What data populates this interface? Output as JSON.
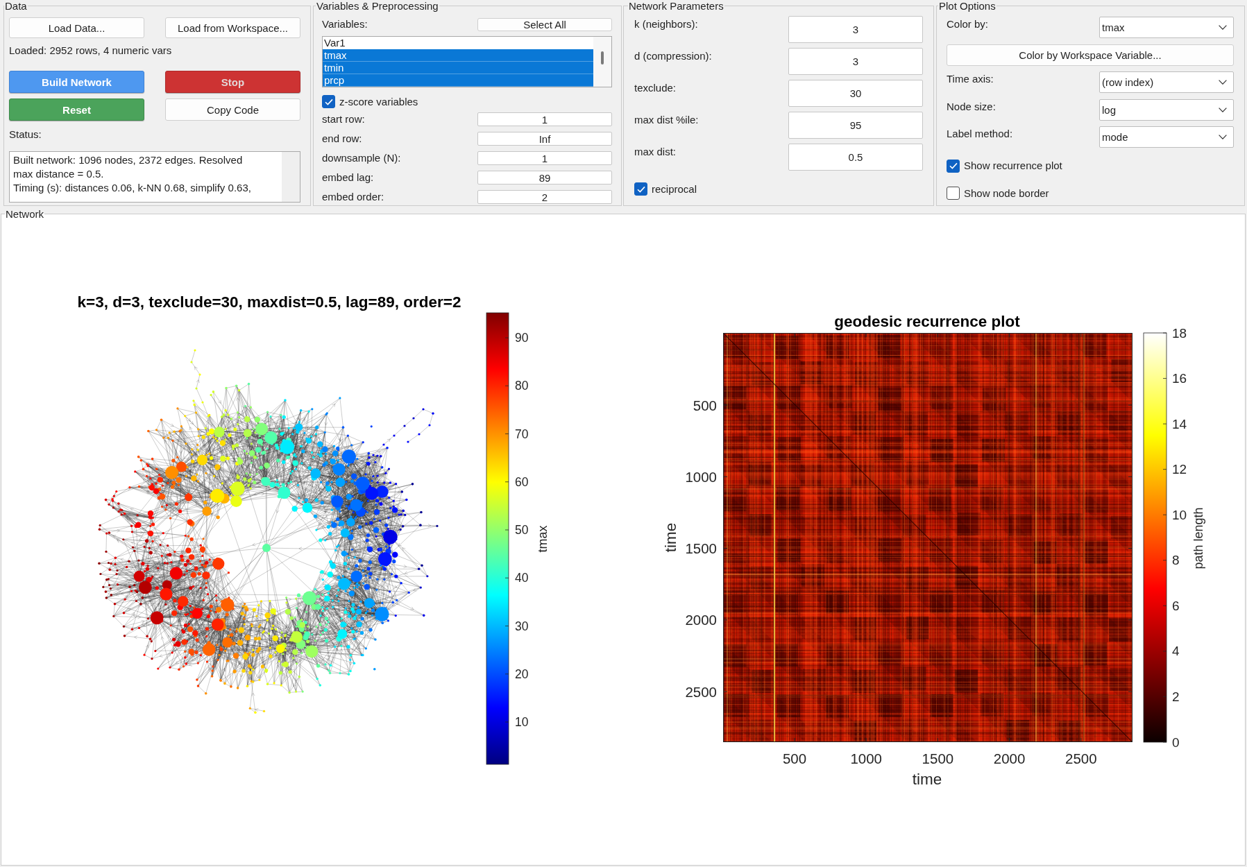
{
  "data_panel": {
    "title": "Data",
    "load_buttons": [
      "Load Data...",
      "Load from Workspace..."
    ],
    "loaded_info": "Loaded: 2952 rows, 4 numeric vars",
    "action_buttons": [
      {
        "label": "Build Network",
        "kind": "primary",
        "disabled": false
      },
      {
        "label": "Stop",
        "kind": "danger",
        "disabled": true
      },
      {
        "label": "Reset",
        "kind": "success",
        "disabled": false
      },
      {
        "label": "Copy Code",
        "kind": "plain",
        "disabled": false
      }
    ],
    "status_label": "Status:",
    "status_lines": [
      "Built network: 1096 nodes, 2372 edges. Resolved max distance = 0.5.",
      "Timing (s): distances 0.06, k-NN 0.68, simplify 0.63,"
    ]
  },
  "variables_panel": {
    "title": "Variables & Preprocessing",
    "variables_label": "Variables:",
    "select_all_button": "Select All",
    "variables": [
      {
        "name": "Var1",
        "selected": false
      },
      {
        "name": "tmax",
        "selected": true
      },
      {
        "name": "tmin",
        "selected": true
      },
      {
        "name": "prcp",
        "selected": true
      }
    ],
    "zscore": {
      "label": "z-score variables",
      "checked": true
    },
    "fields": [
      {
        "label": "start row:",
        "value": "1"
      },
      {
        "label": "end row:",
        "value": "Inf"
      },
      {
        "label": "downsample (N):",
        "value": "1"
      },
      {
        "label": "embed lag:",
        "value": "89"
      },
      {
        "label": "embed order:",
        "value": "2"
      }
    ]
  },
  "network_parameters": {
    "title": "Network Parameters",
    "fields": [
      {
        "label": "k (neighbors):",
        "value": "3"
      },
      {
        "label": "d (compression):",
        "value": "3"
      },
      {
        "label": "texclude:",
        "value": "30"
      },
      {
        "label": "max dist %ile:",
        "value": "95"
      },
      {
        "label": "max dist:",
        "value": "0.5"
      }
    ],
    "reciprocal": {
      "label": "reciprocal",
      "checked": true
    }
  },
  "plot_options": {
    "title": "Plot Options",
    "rows": [
      {
        "kind": "dropdown",
        "label": "Color by:",
        "value": "tmax"
      },
      {
        "kind": "button",
        "label": "Color by Workspace Variable..."
      },
      {
        "kind": "dropdown",
        "label": "Time axis:",
        "value": "(row index)"
      },
      {
        "kind": "dropdown",
        "label": "Node size:",
        "value": "log"
      },
      {
        "kind": "dropdown",
        "label": "Label method:",
        "value": "mode"
      },
      {
        "kind": "checkbox",
        "label": "Show recurrence plot",
        "checked": true
      },
      {
        "kind": "checkbox",
        "label": "Show node border",
        "checked": false
      }
    ]
  },
  "network_panel": {
    "title": "Network",
    "network_plot": {
      "title": "k=3, d=3, texclude=30, maxdist=0.5, lag=89, order=2",
      "colorbar": {
        "label": "tmax",
        "ticks": [
          "90",
          "80",
          "70",
          "60",
          "50",
          "40",
          "30",
          "20",
          "10"
        ]
      }
    },
    "recurrence_plot": {
      "title": "geodesic recurrence plot",
      "xlabel": "time",
      "ylabel": "time",
      "xticks": [
        "500",
        "1000",
        "1500",
        "2000",
        "2500"
      ],
      "yticks": [
        "500",
        "1000",
        "1500",
        "2000",
        "2500"
      ],
      "colorbar": {
        "label": "path length",
        "ticks": [
          "18",
          "16",
          "14",
          "12",
          "10",
          "8",
          "6",
          "4",
          "2",
          "0"
        ]
      }
    }
  }
}
